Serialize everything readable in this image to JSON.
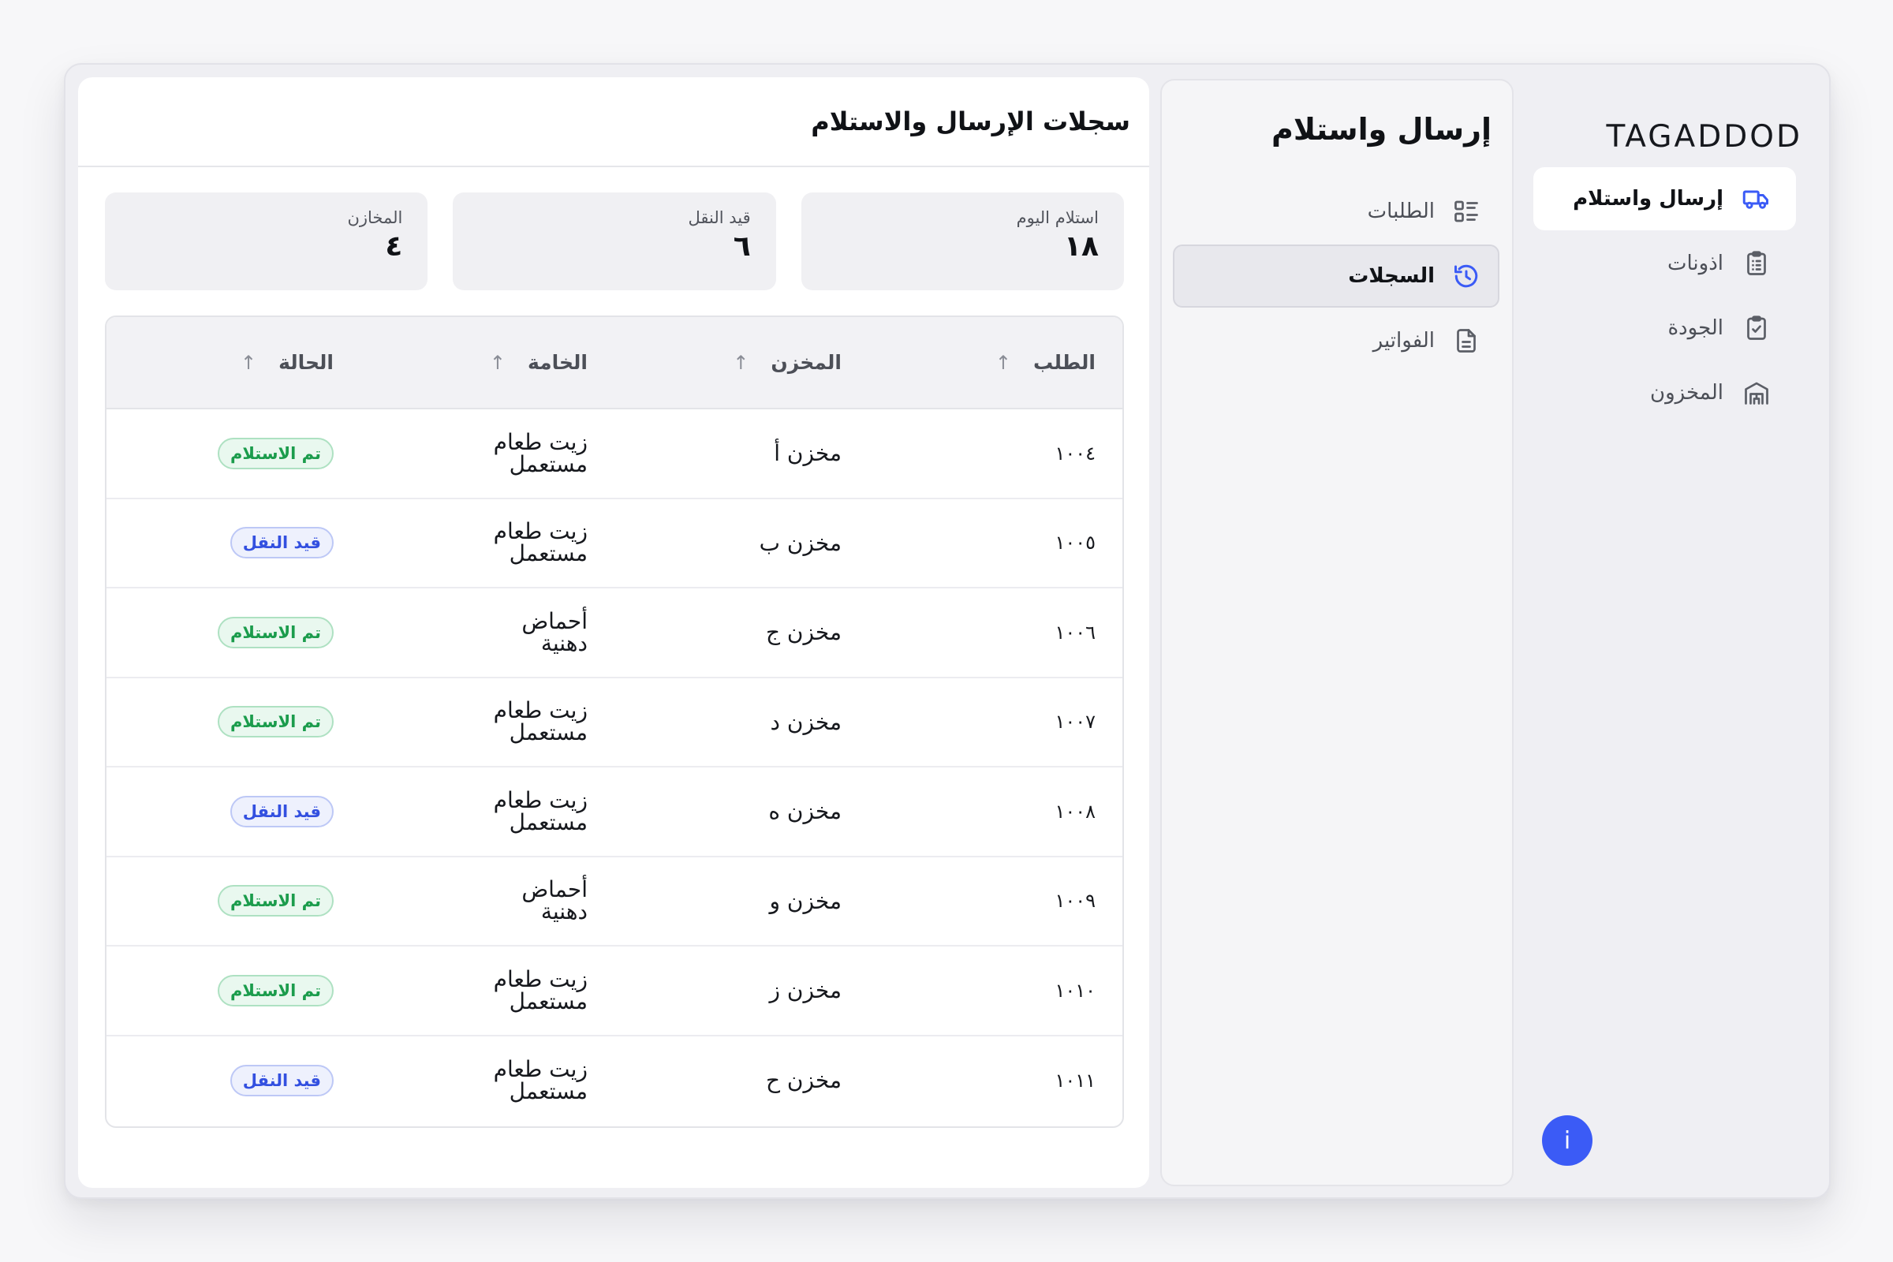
{
  "brand": {
    "logo_text": "TAGADDOD",
    "accent": "#3b5bf6"
  },
  "main_nav": {
    "items": [
      {
        "label": "إرسال واستلام",
        "icon": "truck-icon",
        "active": true
      },
      {
        "label": "اذونات",
        "icon": "clipboard-list-icon",
        "active": false
      },
      {
        "label": "الجودة",
        "icon": "clipboard-check-icon",
        "active": false
      },
      {
        "label": "المخزون",
        "icon": "warehouse-icon",
        "active": false
      }
    ]
  },
  "info_button": {
    "label": "i"
  },
  "sub_panel": {
    "title": "إرسال واستلام",
    "items": [
      {
        "label": "الطلبات",
        "icon": "list-details-icon",
        "active": false
      },
      {
        "label": "السجلات",
        "icon": "history-icon",
        "active": true
      },
      {
        "label": "الفواتير",
        "icon": "file-text-icon",
        "active": false
      }
    ]
  },
  "content": {
    "title": "سجلات الإرسال والاستلام",
    "stats": [
      {
        "label": "استلام اليوم",
        "value": "١٨"
      },
      {
        "label": "قيد النقل",
        "value": "٦"
      },
      {
        "label": "المخازن",
        "value": "٤"
      }
    ],
    "table": {
      "headers": [
        "الطلب",
        "المخزن",
        "الخامة",
        "الحالة"
      ],
      "rows": [
        {
          "id": "١٠٠٤",
          "warehouse": "مخزن أ",
          "material": "زيت طعام مستعمل",
          "status": "تم الاستلام",
          "status_type": "done"
        },
        {
          "id": "١٠٠٥",
          "warehouse": "مخزن ب",
          "material": "زيت طعام مستعمل",
          "status": "قيد النقل",
          "status_type": "transit"
        },
        {
          "id": "١٠٠٦",
          "warehouse": "مخزن ج",
          "material": "أحماض دهنية",
          "status": "تم الاستلام",
          "status_type": "done"
        },
        {
          "id": "١٠٠٧",
          "warehouse": "مخزن د",
          "material": "زيت طعام مستعمل",
          "status": "تم الاستلام",
          "status_type": "done"
        },
        {
          "id": "١٠٠٨",
          "warehouse": "مخزن ه",
          "material": "زيت طعام مستعمل",
          "status": "قيد النقل",
          "status_type": "transit"
        },
        {
          "id": "١٠٠٩",
          "warehouse": "مخزن و",
          "material": "أحماض دهنية",
          "status": "تم الاستلام",
          "status_type": "done"
        },
        {
          "id": "١٠١٠",
          "warehouse": "مخزن ز",
          "material": "زيت طعام مستعمل",
          "status": "تم الاستلام",
          "status_type": "done"
        },
        {
          "id": "١٠١١",
          "warehouse": "مخزن ح",
          "material": "زيت طعام مستعمل",
          "status": "قيد النقل",
          "status_type": "transit"
        }
      ]
    }
  }
}
